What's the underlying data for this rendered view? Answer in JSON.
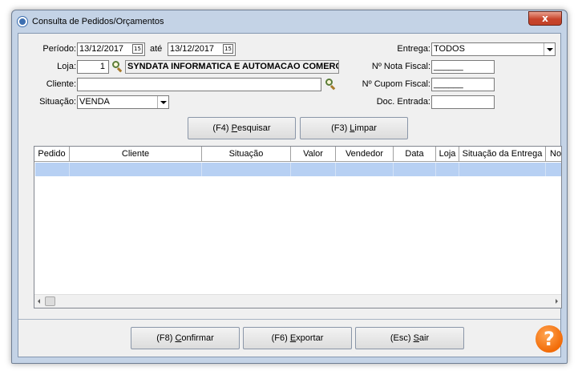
{
  "window": {
    "title": "Consulta de Pedidos/Orçamentos",
    "close_label": "x"
  },
  "filters": {
    "periodo_label": "Período:",
    "periodo_de": "13/12/2017",
    "ate_label": "até",
    "periodo_ate": "13/12/2017",
    "calendar_glyph": "15",
    "loja_label": "Loja:",
    "loja_codigo": "1",
    "loja_nome": "SYNDATA INFORMATICA E AUTOMACAO COMERCIAL",
    "cliente_label": "Cliente:",
    "cliente_value": "",
    "situacao_label": "Situação:",
    "situacao_value": "VENDA",
    "entrega_label": "Entrega:",
    "entrega_value": "TODOS",
    "nota_fiscal_label": "Nº Nota Fiscal:",
    "nota_fiscal_value": "______",
    "cupom_fiscal_label": "Nº Cupom Fiscal:",
    "cupom_fiscal_value": "______",
    "doc_entrada_label": "Doc. Entrada:",
    "doc_entrada_value": ""
  },
  "actions": {
    "pesquisar_prefix": "(F4) ",
    "pesquisar_key": "P",
    "pesquisar_rest": "esquisar",
    "limpar_prefix": "(F3) ",
    "limpar_key": "L",
    "limpar_rest": "impar"
  },
  "grid": {
    "columns": [
      "Pedido",
      "Cliente",
      "Situação",
      "Valor",
      "Vendedor",
      "Data",
      "Loja",
      "Situação da Entrega",
      "No"
    ]
  },
  "footer": {
    "confirmar_prefix": "(F8) ",
    "confirmar_key": "C",
    "confirmar_rest": "onfirmar",
    "exportar_prefix": "(F6) ",
    "exportar_key": "E",
    "exportar_rest": "xportar",
    "sair_prefix": "(Esc) ",
    "sair_key": "S",
    "sair_rest": "air",
    "help_glyph": "?"
  },
  "colors": {
    "accent": "#f26b07",
    "selection": "#b7d0f3",
    "frame": "#c4d3e6"
  }
}
